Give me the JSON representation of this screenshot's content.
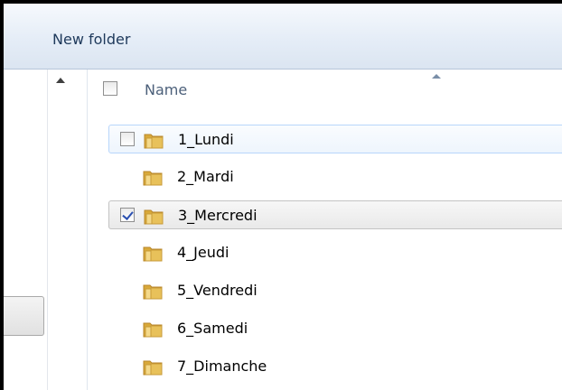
{
  "toolbar": {
    "new_folder_label": "New folder"
  },
  "columns": {
    "name_label": "Name"
  },
  "colors": {
    "toolbar_bg": "#e5edf7",
    "hover_border": "#b8d6fb",
    "folder": "#e8c15a"
  },
  "folders": [
    {
      "label": "1_Lundi",
      "checkbox_visible": true,
      "checked": false,
      "state": "hover"
    },
    {
      "label": "2_Mardi",
      "checkbox_visible": false,
      "checked": false,
      "state": "normal"
    },
    {
      "label": "3_Mercredi",
      "checkbox_visible": true,
      "checked": true,
      "state": "selected"
    },
    {
      "label": "4_Jeudi",
      "checkbox_visible": false,
      "checked": false,
      "state": "normal"
    },
    {
      "label": "5_Vendredi",
      "checkbox_visible": false,
      "checked": false,
      "state": "normal"
    },
    {
      "label": "6_Samedi",
      "checkbox_visible": false,
      "checked": false,
      "state": "normal"
    },
    {
      "label": "7_Dimanche",
      "checkbox_visible": false,
      "checked": false,
      "state": "normal"
    }
  ]
}
